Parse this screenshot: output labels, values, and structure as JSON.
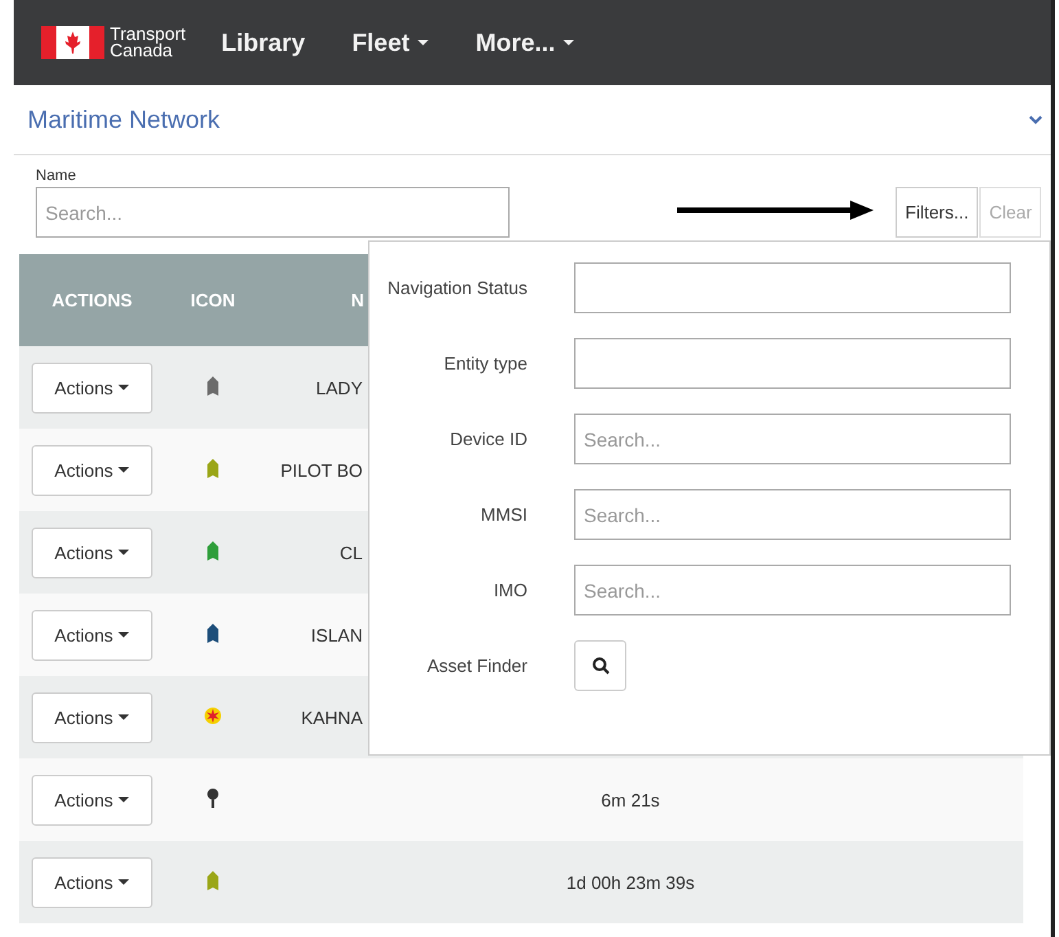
{
  "navbar": {
    "brand": [
      "Transport",
      "Canada"
    ],
    "items": [
      {
        "label": "Library",
        "dropdown": false
      },
      {
        "label": "Fleet",
        "dropdown": true
      },
      {
        "label": "More...",
        "dropdown": true
      }
    ]
  },
  "panel": {
    "title": "Maritime Network"
  },
  "name_filter": {
    "label": "Name",
    "placeholder": "Search..."
  },
  "buttons": {
    "filters": "Filters...",
    "clear": "Clear"
  },
  "table": {
    "columns": [
      "ACTIONS",
      "ICON",
      "N"
    ],
    "rows": [
      {
        "action": "Actions",
        "kind": "boat",
        "color": "#6b6b6b",
        "name": "LADY"
      },
      {
        "action": "Actions",
        "kind": "boat",
        "color": "#9aa617",
        "name": "PILOT BO"
      },
      {
        "action": "Actions",
        "kind": "boat",
        "color": "#2e9e3a",
        "name": "CL"
      },
      {
        "action": "Actions",
        "kind": "boat",
        "color": "#1d4e7a",
        "name": "ISLAN"
      },
      {
        "action": "Actions",
        "kind": "light",
        "color": "#e0202a",
        "name": "KAHNA"
      },
      {
        "action": "Actions",
        "kind": "pin",
        "color": "#333333",
        "time": "6m 21s"
      },
      {
        "action": "Actions",
        "kind": "boat",
        "color": "#9aa617",
        "time": "1d 00h 23m 39s"
      }
    ]
  },
  "filter_popup": {
    "fields": [
      {
        "label": "Navigation Status",
        "kind": "input"
      },
      {
        "label": "Entity type",
        "kind": "input"
      },
      {
        "label": "Device ID",
        "kind": "input",
        "placeholder": "Search..."
      },
      {
        "label": "MMSI",
        "kind": "input",
        "placeholder": "Search..."
      },
      {
        "label": "IMO",
        "kind": "input",
        "placeholder": "Search..."
      },
      {
        "label": "Asset Finder",
        "kind": "search-button"
      }
    ]
  }
}
